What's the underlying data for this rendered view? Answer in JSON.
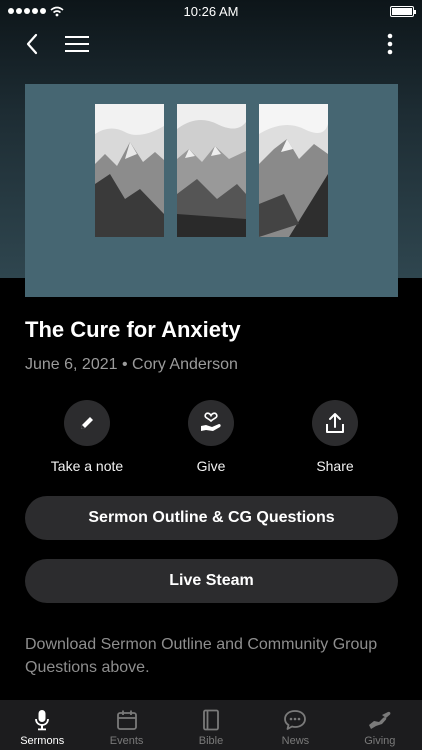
{
  "status": {
    "time": "10:26 AM"
  },
  "sermon": {
    "title": "The Cure for Anxiety",
    "date": "June 6, 2021",
    "separator": "•",
    "speaker": "Cory Anderson",
    "description": "Download Sermon Outline and Community Group Questions above."
  },
  "actions": [
    {
      "label": "Take a note",
      "icon": "pencil-icon"
    },
    {
      "label": "Give",
      "icon": "hand-heart-icon"
    },
    {
      "label": "Share",
      "icon": "share-icon"
    }
  ],
  "buttons": {
    "outline": "Sermon Outline & CG Questions",
    "live": "Live Steam"
  },
  "tabs": [
    {
      "label": "Sermons",
      "icon": "microphone-icon",
      "active": true
    },
    {
      "label": "Events",
      "icon": "calendar-icon",
      "active": false
    },
    {
      "label": "Bible",
      "icon": "book-icon",
      "active": false
    },
    {
      "label": "News",
      "icon": "chat-bubble-icon",
      "active": false
    },
    {
      "label": "Giving",
      "icon": "giving-hand-icon",
      "active": false
    }
  ],
  "colors": {
    "artwork_bg": "#466672",
    "button_bg": "#2c2c2e",
    "tab_bar_bg": "#1c1c1e"
  }
}
